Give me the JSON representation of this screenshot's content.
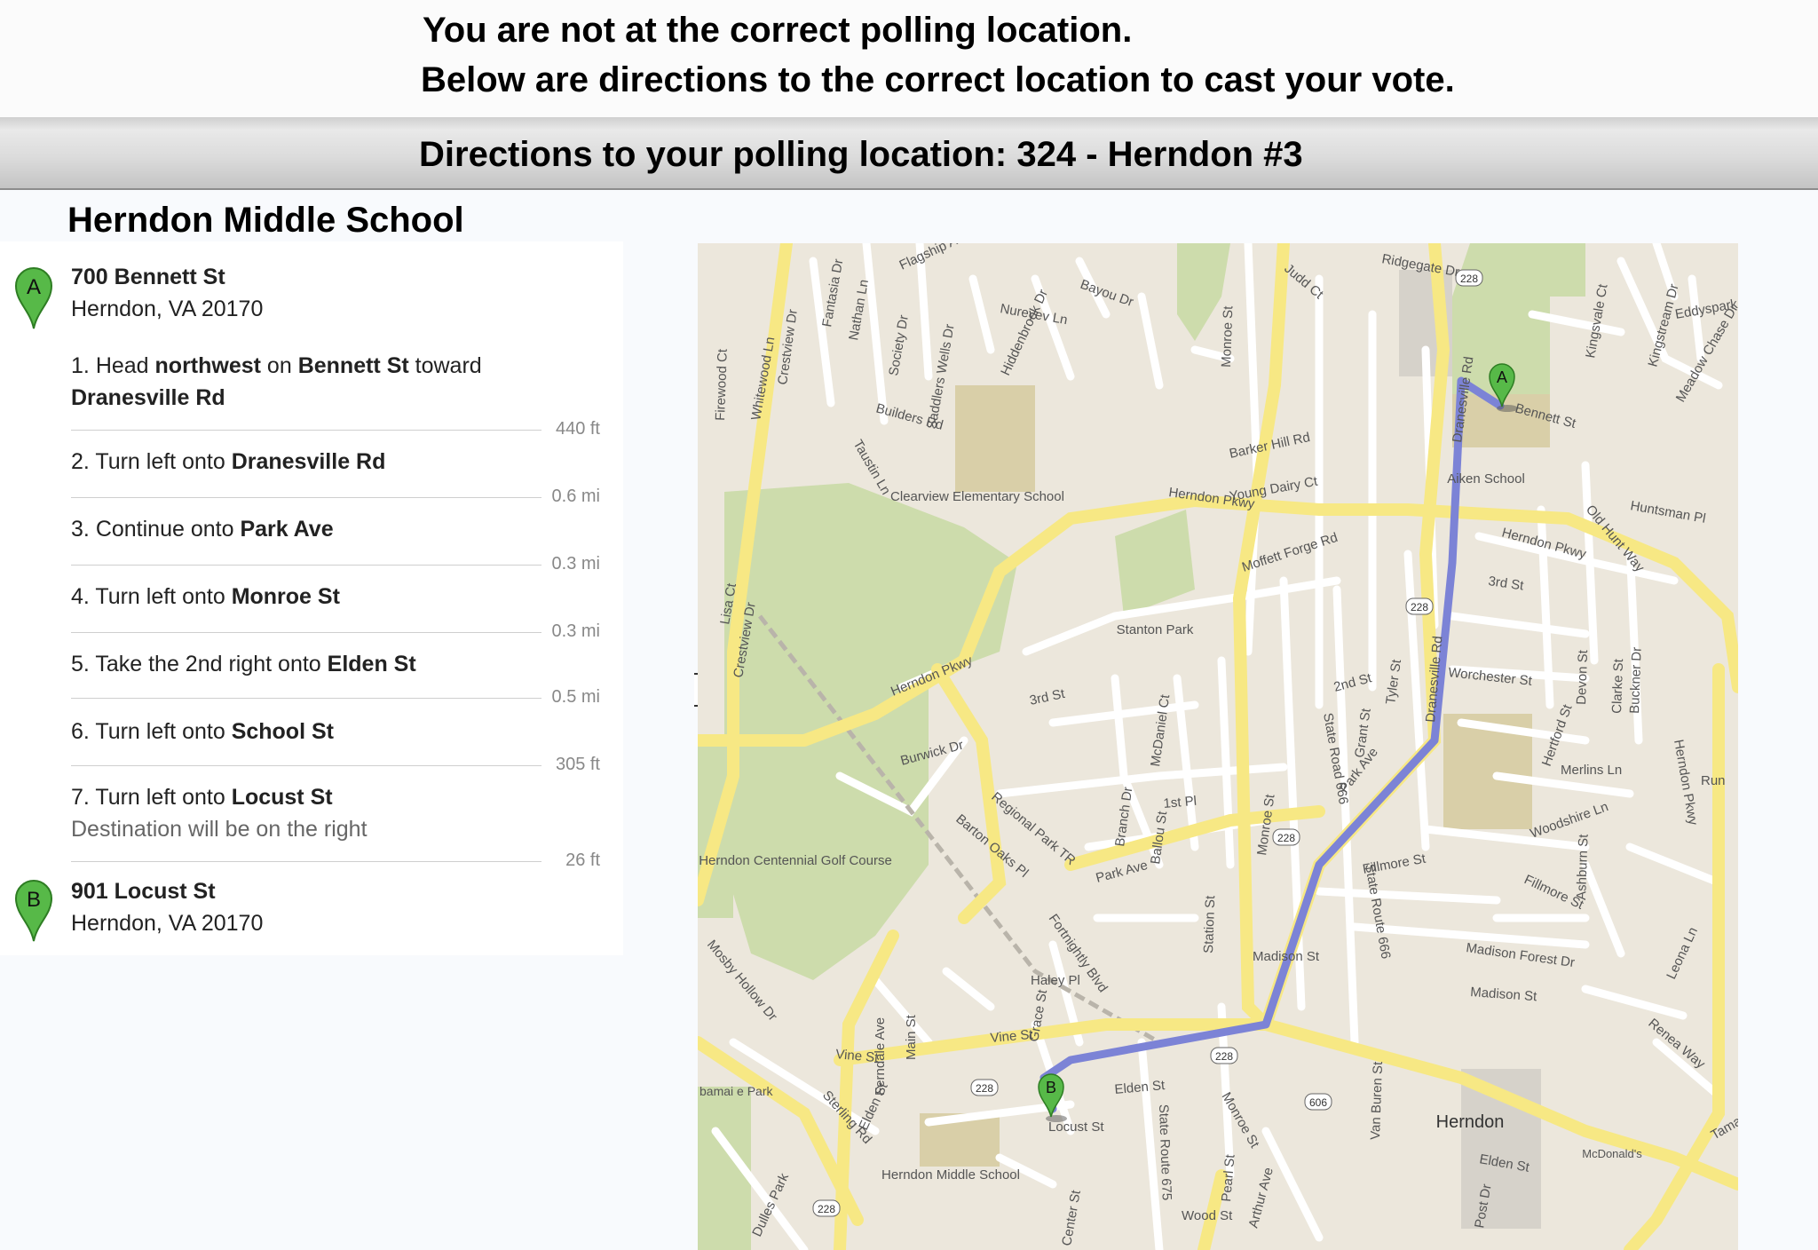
{
  "notice": {
    "line1": "You are not at the correct polling location.",
    "line2": "Below are directions to the correct location to cast your vote."
  },
  "directions_bar": {
    "title": "Directions to your polling location:  324 - Herndon #3"
  },
  "school_name": "Herndon Middle School",
  "origin": {
    "marker": "A",
    "street": "700 Bennett St",
    "city": "Herndon, VA 20170"
  },
  "destination": {
    "marker": "B",
    "street": "901 Locust St",
    "city": "Herndon, VA 20170"
  },
  "steps": [
    {
      "num": "1.",
      "parts": [
        "Head ",
        "northwest",
        " on ",
        "Bennett St",
        " toward "
      ],
      "line2": "Dranesville Rd",
      "distance": "440 ft"
    },
    {
      "num": "2.",
      "pre": "Turn left onto ",
      "road": "Dranesville Rd",
      "distance": "0.6 mi"
    },
    {
      "num": "3.",
      "pre": "Continue onto ",
      "road": "Park Ave",
      "distance": "0.3 mi"
    },
    {
      "num": "4.",
      "pre": "Turn left onto ",
      "road": "Monroe St",
      "distance": "0.3 mi"
    },
    {
      "num": "5.",
      "pre": "Take the 2nd right onto ",
      "road": "Elden St",
      "distance": "0.5 mi"
    },
    {
      "num": "6.",
      "pre": "Turn left onto ",
      "road": "School St",
      "distance": "305 ft"
    },
    {
      "num": "7.",
      "pre": "Turn left onto ",
      "road": "Locust St",
      "note": "Destination will be on the right",
      "distance": "26 ft"
    }
  ],
  "map": {
    "marker_a": "A",
    "marker_b": "B",
    "places": {
      "clearview": "Clearview Elementary School",
      "stanton": "Stanton Park",
      "aiken": "Aiken School",
      "golf": "Herndon Centennial Golf Course",
      "middle": "Herndon Middle School",
      "herndon": "Herndon",
      "mcdonalds": "McDonald's",
      "bamai": "bamai e Park"
    },
    "streets": {
      "pkwy1": "Herndon Pkwy",
      "pkwy2": "Herndon Pkwy",
      "pkwy3": "Herndon Pkwy",
      "pkwy4": "Herndon Pkwy",
      "park_ave": "Park Ave",
      "park_ave2": "Park Ave",
      "elden": "Elden St",
      "elden2": "Elden St",
      "elden3": "Elden St",
      "locust": "Locust St",
      "dranesville": "Dranesville Rd",
      "dranesville2": "Dranesville Rd",
      "monroe": "Monroe St",
      "monroe2": "Monroe St",
      "monroe3": "Monroe St",
      "crestview": "Crestview Dr",
      "crestview2": "Crestview Dr",
      "ferndale": "Ferndale Ave",
      "sterling": "Sterling Rd",
      "bennett": "Bennett St",
      "third": "3rd St",
      "third2": "3rd St",
      "second": "2nd St",
      "worchester": "Worchester St",
      "fillmore": "Fillmore St",
      "fillmore2": "Fillmore St",
      "madison": "Madison St",
      "madison2": "Madison St",
      "madison_forest": "Madison Forest Dr",
      "moffett": "Moffett Forge Rd",
      "young_dairy": "Young Dairy Ct",
      "barker": "Barker Hill Rd",
      "builders": "Builders Rd",
      "nureyev": "Nureyev Ln",
      "vine": "Vine St",
      "vine2": "Vine St",
      "haley": "Haley Pl",
      "fortnightly": "Fortnightly Blvd",
      "regional": "Regional Park TR",
      "barton": "Barton Oaks Pl",
      "state_road_666": "State Road 666",
      "state_route_666": "State Route 666",
      "state_route_675": "State Route 675",
      "huntsman": "Huntsman Pl",
      "old_hunt": "Old Hunt Way",
      "merlins": "Merlins Ln",
      "woodshire": "Woodshire Ln",
      "station": "Station St",
      "first": "1st Pl",
      "grant": "Grant St",
      "tyler": "Tyler St",
      "van_buren": "Van Buren St",
      "pearl": "Pearl St",
      "wood": "Wood St",
      "main": "Main St",
      "mosby": "Mosby Hollow Dr",
      "burwick": "Burwick Dr",
      "mcdaniel": "McDaniel Ct",
      "ballou": "Ballou St",
      "branch": "Branch Dr",
      "saddlers": "Saddlers Wells Dr",
      "hiddenbrook": "Hiddenbrook Dr",
      "society": "Society Dr",
      "nathan": "Nathan Ln",
      "taustin": "Taustin Ln",
      "fantasia": "Fantasia Dr",
      "whitewood": "Whitewood Ln",
      "firewood": "Firewood Ct",
      "flagship": "Flagship Ave",
      "bayou": "Bayou Dr",
      "judd": "Judd Ct",
      "ridgegate": "Ridgegate Dr",
      "kingsvale": "Kingsvale Ct",
      "kingstream": "Kingstream Dr",
      "meadow_chase": "Meadow Chase Dr",
      "eddyspark": "Eddyspark",
      "devon": "Devon St",
      "clarke": "Clarke St",
      "buckner": "Buckner Dr",
      "leona": "Leona Ln",
      "renea": "Renea Way",
      "ashburn": "Ashburn St",
      "hertford": "Hertford St",
      "dulles_park": "Dulles Park",
      "lisa": "Lisa Ct",
      "center": "Center St",
      "post": "Post Dr",
      "arthur": "Arthur Ave",
      "grace": "Grace St",
      "elden_dr": "Elden St",
      "tamar": "Tamar",
      "run": "Run",
      "r228_1": "228",
      "r228_2": "228",
      "r228_3": "228",
      "r228_4": "228",
      "r228_5": "228",
      "r228_6": "228",
      "r606": "606",
      "r666": "666"
    }
  },
  "colors": {
    "route": "#7c83d6",
    "major_road": "#f7e884",
    "park": "#cddcac",
    "school_lot": "#d9cfa8",
    "marker": "#57b948"
  }
}
